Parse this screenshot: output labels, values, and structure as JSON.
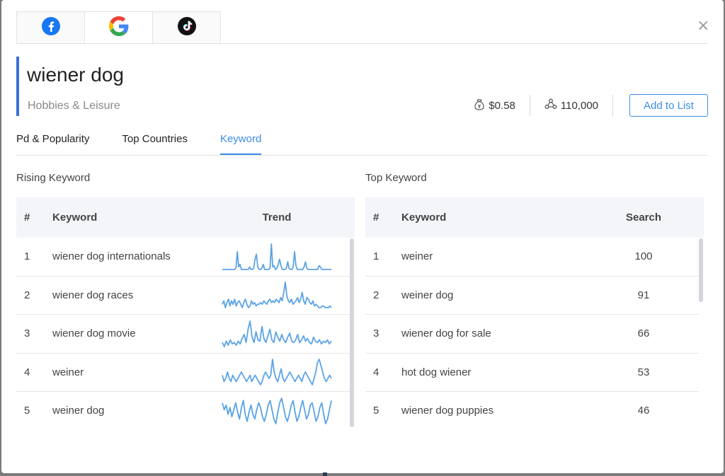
{
  "platforms": [
    {
      "name": "facebook-icon",
      "active": false
    },
    {
      "name": "google-icon",
      "active": true
    },
    {
      "name": "tiktok-icon",
      "active": false
    }
  ],
  "header": {
    "title": "wiener dog",
    "category": "Hobbies & Leisure",
    "cpc": "$0.58",
    "volume": "110,000",
    "add_button": "Add to List",
    "close_icon": "×"
  },
  "section_tabs": [
    "Pd & Popularity",
    "Top Countries",
    "Keyword"
  ],
  "active_tab": "Keyword",
  "rising": {
    "title": "Rising Keyword",
    "columns": [
      "#",
      "Keyword",
      "Trend"
    ],
    "rows": [
      {
        "n": "1",
        "keyword": "wiener dog internationals",
        "trend": [
          0,
          0,
          0,
          0,
          0,
          0,
          0,
          0,
          0,
          0,
          1,
          14,
          2,
          4,
          0,
          0,
          0,
          0,
          0,
          0,
          2,
          0,
          0,
          1,
          8,
          12,
          2,
          0,
          0,
          1,
          4,
          0,
          0,
          0,
          0,
          1,
          20,
          2,
          3,
          0,
          1,
          4,
          8,
          3,
          0,
          0,
          0,
          1,
          6,
          1,
          0,
          0,
          2,
          14,
          3,
          0,
          0,
          0,
          0,
          0,
          2,
          6,
          1,
          0,
          0,
          0,
          0,
          0,
          0,
          0,
          0,
          3,
          2,
          0,
          0,
          0,
          0,
          0,
          0,
          0,
          0
        ]
      },
      {
        "n": "2",
        "keyword": "wiener dog races",
        "trend": [
          3,
          5,
          1,
          4,
          6,
          2,
          5,
          3,
          6,
          2,
          4,
          5,
          3,
          1,
          4,
          6,
          3,
          1,
          2,
          5,
          3,
          4,
          2,
          3,
          3,
          4,
          3,
          5,
          4,
          3,
          5,
          6,
          4,
          5,
          4,
          6,
          5,
          4,
          7,
          5,
          10,
          16,
          8,
          5,
          4,
          6,
          3,
          4,
          5,
          7,
          4,
          6,
          10,
          5,
          3,
          7,
          6,
          4,
          3,
          5,
          2,
          3,
          2,
          1,
          1,
          2,
          2,
          1,
          1,
          1,
          2,
          1
        ]
      },
      {
        "n": "3",
        "keyword": "wiener dog movie",
        "trend": [
          4,
          1,
          5,
          2,
          6,
          3,
          4,
          2,
          5,
          3,
          7,
          10,
          4,
          14,
          20,
          8,
          4,
          12,
          6,
          5,
          16,
          7,
          4,
          9,
          14,
          6,
          4,
          12,
          8,
          5,
          10,
          6,
          4,
          8,
          11,
          5,
          4,
          6,
          10,
          4,
          6,
          9,
          5,
          7,
          4,
          3,
          8,
          5,
          4,
          6,
          3,
          5,
          4,
          6,
          3,
          5
        ]
      },
      {
        "n": "4",
        "keyword": "weiner",
        "trend": [
          5,
          3,
          4,
          6,
          4,
          3,
          5,
          4,
          3,
          4,
          5,
          6,
          5,
          4,
          3,
          4,
          5,
          3,
          4,
          5,
          4,
          3,
          2,
          3,
          5,
          6,
          5,
          4,
          5,
          10,
          6,
          4,
          3,
          5,
          7,
          4,
          3,
          4,
          5,
          6,
          5,
          4,
          3,
          4,
          5,
          4,
          3,
          5,
          6,
          5,
          4,
          3,
          2,
          4,
          6,
          9,
          10,
          8,
          6,
          4,
          3,
          4,
          5,
          4
        ]
      },
      {
        "n": "5",
        "keyword": "weiner dog",
        "trend": [
          11,
          8,
          10,
          6,
          9,
          5,
          8,
          11,
          7,
          4,
          9,
          12,
          6,
          3,
          7,
          10,
          6,
          4,
          8,
          11,
          9,
          5,
          3,
          6,
          10,
          12,
          8,
          4,
          2,
          7,
          11,
          13,
          9,
          5,
          3,
          6,
          10,
          12,
          7,
          3,
          5,
          9,
          12,
          8,
          4,
          6,
          10,
          11,
          7,
          3,
          5,
          9,
          11,
          6,
          2,
          4,
          8,
          12
        ]
      }
    ]
  },
  "top": {
    "title": "Top Keyword",
    "columns": [
      "#",
      "Keyword",
      "Search"
    ],
    "rows": [
      {
        "n": "1",
        "keyword": "weiner",
        "search": "100"
      },
      {
        "n": "2",
        "keyword": "weiner dog",
        "search": "91"
      },
      {
        "n": "3",
        "keyword": "wiener dog for sale",
        "search": "66"
      },
      {
        "n": "4",
        "keyword": "hot dog wiener",
        "search": "53"
      },
      {
        "n": "5",
        "keyword": "wiener dog puppies",
        "search": "46"
      }
    ]
  },
  "colors": {
    "accent": "#3b8de8",
    "trend_line": "#5ba3e6",
    "accent_bar": "#3a6fd8"
  }
}
